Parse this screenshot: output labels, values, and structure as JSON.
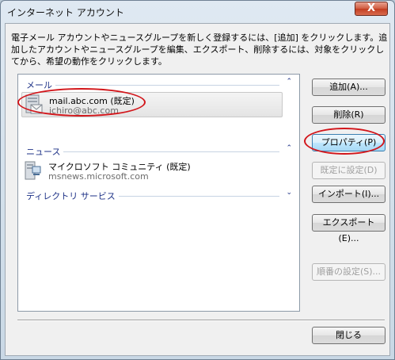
{
  "window": {
    "title": "インターネット アカウント",
    "close_glyph": "X"
  },
  "description": "電子メール アカウントやニュースグループを新しく登録するには、[追加] をクリックします。追加したアカウントやニュースグループを編集、エクスポート、削除するには、対象をクリックしてから、希望の動作をクリックします。",
  "groups": {
    "mail": {
      "header": "メール",
      "chevron": "⌃",
      "account": {
        "name": "mail.abc.com (既定)",
        "sub": "ichiro@abc.com",
        "icon": "mail-account-icon"
      }
    },
    "news": {
      "header": "ニュース",
      "chevron": "⌃",
      "account": {
        "name": "マイクロソフト コミュニティ (既定)",
        "sub": "msnews.microsoft.com",
        "icon": "news-server-icon"
      }
    },
    "directory": {
      "header": "ディレクトリ サービス",
      "chevron": "⌄"
    }
  },
  "buttons": {
    "add": "追加(A)...",
    "remove": "削除(R)",
    "properties": "プロパティ(P)",
    "set_default": "既定に設定(D)",
    "import": "インポート(I)...",
    "export": "エクスポート(E)...",
    "set_order": "順番の設定(S)...",
    "close": "閉じる"
  },
  "colors": {
    "annotation_red": "#d2161b",
    "group_header_blue": "#1e3287"
  }
}
